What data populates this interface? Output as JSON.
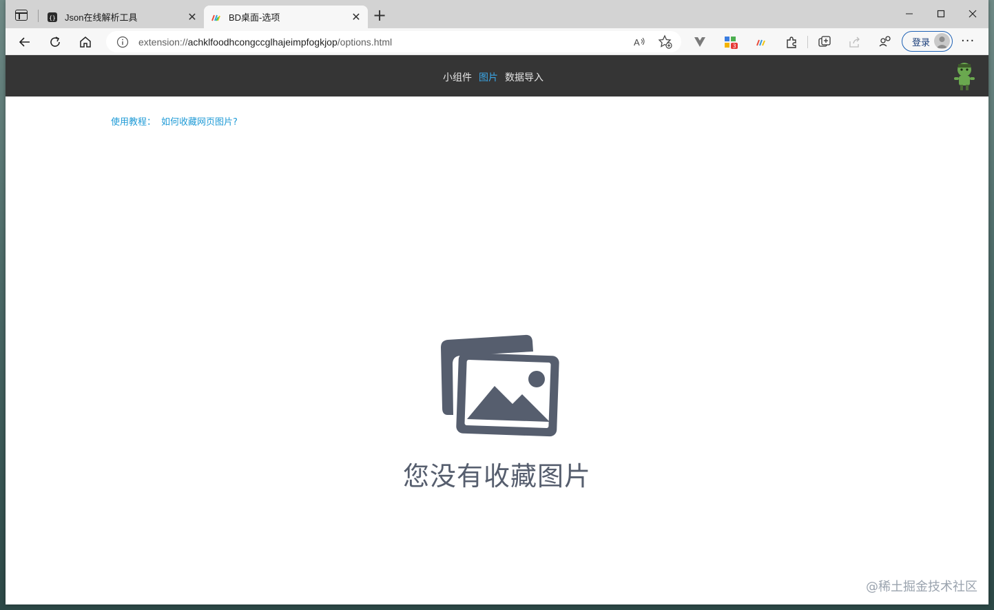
{
  "tabs": [
    {
      "title": "Json在线解析工具",
      "icon": "json-tool-icon"
    },
    {
      "title": "BD桌面-选项",
      "icon": "bd-desktop-icon"
    }
  ],
  "address": {
    "scheme": "extension://",
    "host": "achklfoodhcongccglhajeimpfogkjop",
    "path": "/options.html"
  },
  "toolbar": {
    "login_label": "登录",
    "ext_badge": "3"
  },
  "nav": {
    "items": [
      "小组件",
      "图片",
      "数据导入"
    ],
    "active_index": 1
  },
  "tutorial": {
    "label": "使用教程：",
    "link": "如何收藏网页图片?"
  },
  "empty_state": {
    "message": "您没有收藏图片"
  },
  "watermark": "@稀土掘金技术社区",
  "colors": {
    "accent": "#3aa7e8",
    "header_bg": "#353535",
    "empty_icon": "#565e6e"
  }
}
